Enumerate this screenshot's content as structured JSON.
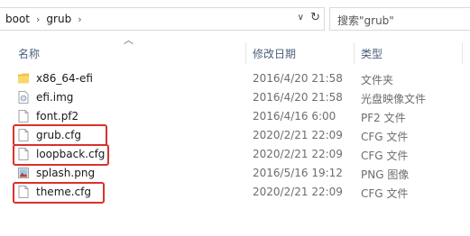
{
  "address": {
    "crumbs": [
      "boot",
      "grub"
    ]
  },
  "search": {
    "placeholder": "搜索\"grub\""
  },
  "columns": {
    "name": "名称",
    "date": "修改日期",
    "type": "类型"
  },
  "files": [
    {
      "name": "x86_64-efi",
      "date": "2016/4/20 21:58",
      "type": "文件夹",
      "icon": "folder-icon",
      "highlighted": false
    },
    {
      "name": "efi.img",
      "date": "2016/4/20 21:58",
      "type": "光盘映像文件",
      "icon": "disc-image-icon",
      "highlighted": false
    },
    {
      "name": "font.pf2",
      "date": "2016/4/16 6:00",
      "type": "PF2 文件",
      "icon": "file-icon",
      "highlighted": false
    },
    {
      "name": "grub.cfg",
      "date": "2020/2/21 22:09",
      "type": "CFG 文件",
      "icon": "file-icon",
      "highlighted": true
    },
    {
      "name": "loopback.cfg",
      "date": "2020/2/21 22:09",
      "type": "CFG 文件",
      "icon": "file-icon",
      "highlighted": true
    },
    {
      "name": "splash.png",
      "date": "2016/5/16 19:12",
      "type": "PNG 图像",
      "icon": "image-icon",
      "highlighted": false
    },
    {
      "name": "theme.cfg",
      "date": "2020/2/21 22:09",
      "type": "CFG 文件",
      "icon": "file-icon",
      "highlighted": true
    }
  ],
  "colors": {
    "highlight_border": "#d9322b",
    "header_text": "#4c607a",
    "folder": "#f5c94a"
  }
}
